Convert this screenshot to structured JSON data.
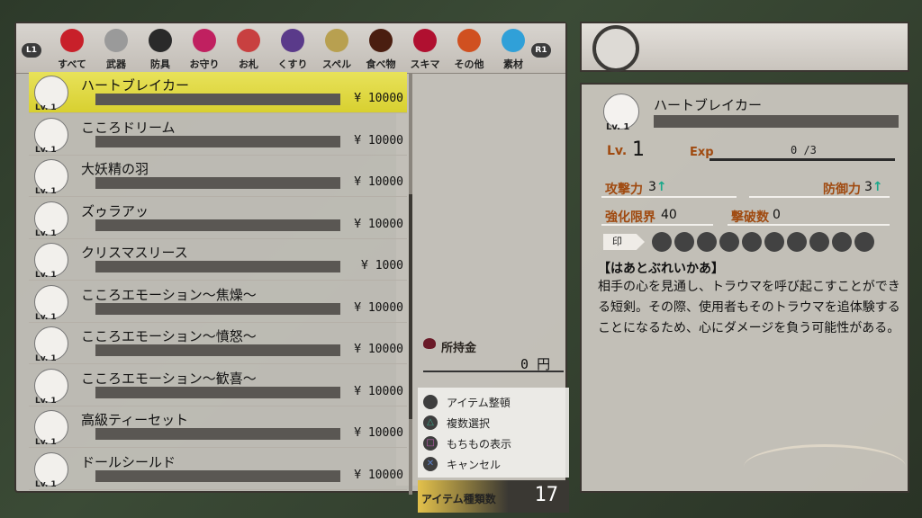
{
  "categories": {
    "left_button": "L1",
    "right_button": "R1",
    "items": [
      {
        "label": "すべて",
        "icon": "bag-icon",
        "color": "#c8202a"
      },
      {
        "label": "武器",
        "icon": "sword-icon",
        "color": "#9a9a9a"
      },
      {
        "label": "防具",
        "icon": "armor-icon",
        "color": "#2a2a2a"
      },
      {
        "label": "お守り",
        "icon": "charm-icon",
        "color": "#c02060"
      },
      {
        "label": "お札",
        "icon": "talisman-icon",
        "color": "#c84040"
      },
      {
        "label": "くすり",
        "icon": "potion-icon",
        "color": "#5a3a8a"
      },
      {
        "label": "スペル",
        "icon": "spellcard-icon",
        "color": "#b8a050"
      },
      {
        "label": "食べ物",
        "icon": "food-icon",
        "color": "#4a1e10"
      },
      {
        "label": "スキマ",
        "icon": "gap-eye-icon",
        "color": "#b01030"
      },
      {
        "label": "その他",
        "icon": "misc-icon",
        "color": "#d05020"
      },
      {
        "label": "素材",
        "icon": "crystal-icon",
        "color": "#30a0d8"
      }
    ]
  },
  "items": [
    {
      "name": "ハートブレイカー",
      "level": "Lv. 1",
      "currency": "¥",
      "price": "10000",
      "selected": true
    },
    {
      "name": "こころドリーム",
      "level": "Lv. 1",
      "currency": "¥",
      "price": "10000"
    },
    {
      "name": "大妖精の羽",
      "level": "Lv. 1",
      "currency": "¥",
      "price": "10000"
    },
    {
      "name": "ズゥラアッ",
      "level": "Lv. 1",
      "currency": "¥",
      "price": "10000"
    },
    {
      "name": "クリスマスリース",
      "level": "Lv. 1",
      "currency": "¥",
      "price": "1000"
    },
    {
      "name": "こころエモーション～焦燥～",
      "level": "Lv. 1",
      "currency": "¥",
      "price": "10000"
    },
    {
      "name": "こころエモーション～憤怒～",
      "level": "Lv. 1",
      "currency": "¥",
      "price": "10000"
    },
    {
      "name": "こころエモーション～歓喜～",
      "level": "Lv. 1",
      "currency": "¥",
      "price": "10000"
    },
    {
      "name": "高級ティーセット",
      "level": "Lv. 1",
      "currency": "¥",
      "price": "10000"
    },
    {
      "name": "ドールシールド",
      "level": "Lv. 1",
      "currency": "¥",
      "price": "10000"
    }
  ],
  "money": {
    "label": "所持金",
    "value": "0",
    "unit": "円"
  },
  "controls": [
    {
      "glyph": "R",
      "label": "アイテム整頓",
      "color": "#3e3e3e"
    },
    {
      "glyph": "△",
      "label": "複数選択",
      "color": "#3aa88a"
    },
    {
      "glyph": "□",
      "label": "もちもの表示",
      "color": "#c060b0"
    },
    {
      "glyph": "✕",
      "label": "キャンセル",
      "color": "#5a80c8"
    }
  ],
  "item_count": {
    "label": "アイテム種類数",
    "value": "17"
  },
  "detail": {
    "level_small": "Lv. 1",
    "name": "ハートブレイカー",
    "lv_label": "Lv.",
    "lv_value": "1",
    "exp_label": "Exp",
    "exp_value": "0 /3",
    "attack_label": "攻撃力",
    "attack_value": "3",
    "defense_label": "防御力",
    "defense_value": "3",
    "limit_label": "強化限界",
    "limit_value": "40",
    "kills_label": "撃破数",
    "kills_value": "0",
    "seal_label": "印",
    "seal_slots": 10,
    "arrow": "↑",
    "desc_title": "【はあとぶれいかあ】",
    "desc_text": "相手の心を見通し、トラウマを呼び起こすことができる短剣。その際、使用者もそのトラウマを追体験することになるため、心にダメージを負う可能性がある。"
  }
}
